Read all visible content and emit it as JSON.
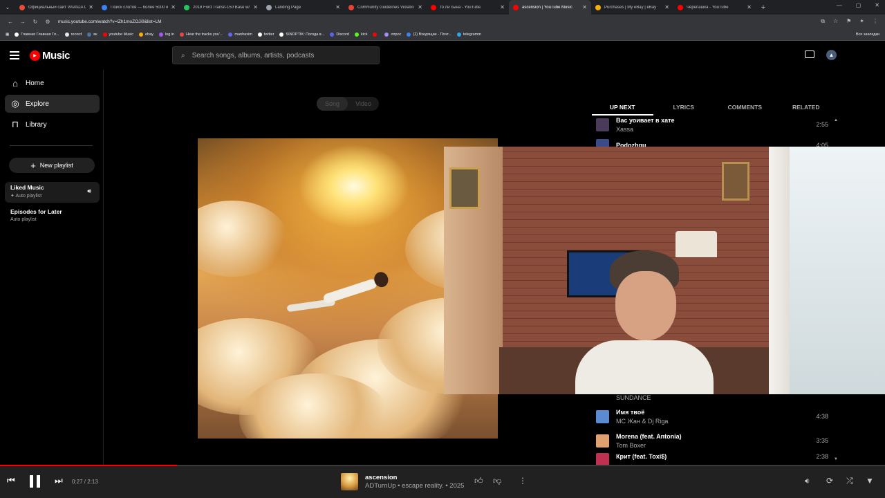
{
  "browser": {
    "tabs": [
      {
        "title": "Официальный сайт VAVADA C",
        "color": "#e74c3c",
        "active": false
      },
      {
        "title": "Поиск слотов — более 5000 и",
        "color": "#3b82f6",
        "active": false
      },
      {
        "title": "2018 Ford Transit-150 Base w/",
        "color": "#22c55e",
        "active": false
      },
      {
        "title": "Landing Page",
        "color": "#9ca3af",
        "active": false
      },
      {
        "title": "Community Guidelines Violatio",
        "color": "#ea4335",
        "active": false
      },
      {
        "title": "то ли сына - YouTube",
        "color": "#ff0000",
        "active": false
      },
      {
        "title": "ascension | YouTube Music",
        "color": "#ff0000",
        "active": true
      },
      {
        "title": "Purchases | My eBay | eBay",
        "color": "#f5af02",
        "active": false
      },
      {
        "title": "Черепашка - YouTube",
        "color": "#ff0000",
        "active": false
      }
    ],
    "url": "music.youtube.com/watch?v=lZh1moZOJi0&list=LM",
    "bookmarks": [
      {
        "label": "Главная Главная Гл...",
        "color": "#ffffff"
      },
      {
        "label": "record",
        "color": "#e5e7eb"
      },
      {
        "label": "вк",
        "color": "#4c75a3"
      },
      {
        "label": "youtube Music",
        "color": "#ff0000"
      },
      {
        "label": "ebay",
        "color": "#f5af02"
      },
      {
        "label": "log in",
        "color": "#a855f7"
      },
      {
        "label": "Hear the tracks you'...",
        "color": "#ef4444"
      },
      {
        "label": "manhaxim",
        "color": "#6366f1"
      },
      {
        "label": "twitter",
        "color": "#ffffff"
      },
      {
        "label": "SINOPTIK: Погода в...",
        "color": "#ffffff"
      },
      {
        "label": "Discord",
        "color": "#5865f2"
      },
      {
        "label": "kick",
        "color": "#53fc18"
      },
      {
        "label": "",
        "color": "#ff0000"
      },
      {
        "label": "опрос",
        "color": "#a78bfa"
      },
      {
        "label": "(2) Входящие - Почт...",
        "color": "#3b82f6"
      },
      {
        "label": "telegramm",
        "color": "#29a9eb"
      }
    ],
    "bookmarks_right": "Все закладки"
  },
  "app": {
    "logo_text": "Music",
    "search_placeholder": "Search songs, albums, artists, podcasts"
  },
  "sidebar": {
    "nav": [
      {
        "label": "Home",
        "icon": "home-icon",
        "glyph": "⌂"
      },
      {
        "label": "Explore",
        "icon": "compass-icon",
        "glyph": "◎"
      },
      {
        "label": "Library",
        "icon": "bookmark-icon",
        "glyph": "⊓"
      }
    ],
    "new_playlist": "New playlist",
    "playlists": [
      {
        "title": "Liked Music",
        "sub": "Auto playlist",
        "playing": true
      },
      {
        "title": "Episodes for Later",
        "sub": "Auto playlist",
        "playing": false
      }
    ]
  },
  "main": {
    "toggle": [
      "Song",
      "Video"
    ]
  },
  "panel": {
    "tabs": [
      "UP NEXT",
      "LYRICS",
      "COMMENTS",
      "RELATED"
    ],
    "queue": [
      {
        "title": "Вас уоивает в хате",
        "artist": "Xassa",
        "duration": "2:55",
        "thumb": "#4a3b5a"
      },
      {
        "title": "Podozhgu",
        "artist": "",
        "duration": "4:05",
        "thumb": "#3a4a8a"
      },
      {
        "title": "Имя твоё",
        "artist": "MC Жан & Dj Riga",
        "duration": "4:38",
        "thumb": "#5a8ad0"
      },
      {
        "title": "Morena (feat. Antonia)",
        "artist": "Tom Boxer",
        "duration": "3:35",
        "thumb": "#e0a070"
      },
      {
        "title": "Крит (feat. Toxi$)",
        "artist": "",
        "duration": "2:38",
        "thumb": "#c03050"
      }
    ],
    "partial_artist": "SUNDANCE"
  },
  "player": {
    "time": "0:27 / 2:13",
    "progress": 0.2,
    "title": "ascension",
    "subtitle": "ADTurnUp • escape reality. • 2025"
  }
}
